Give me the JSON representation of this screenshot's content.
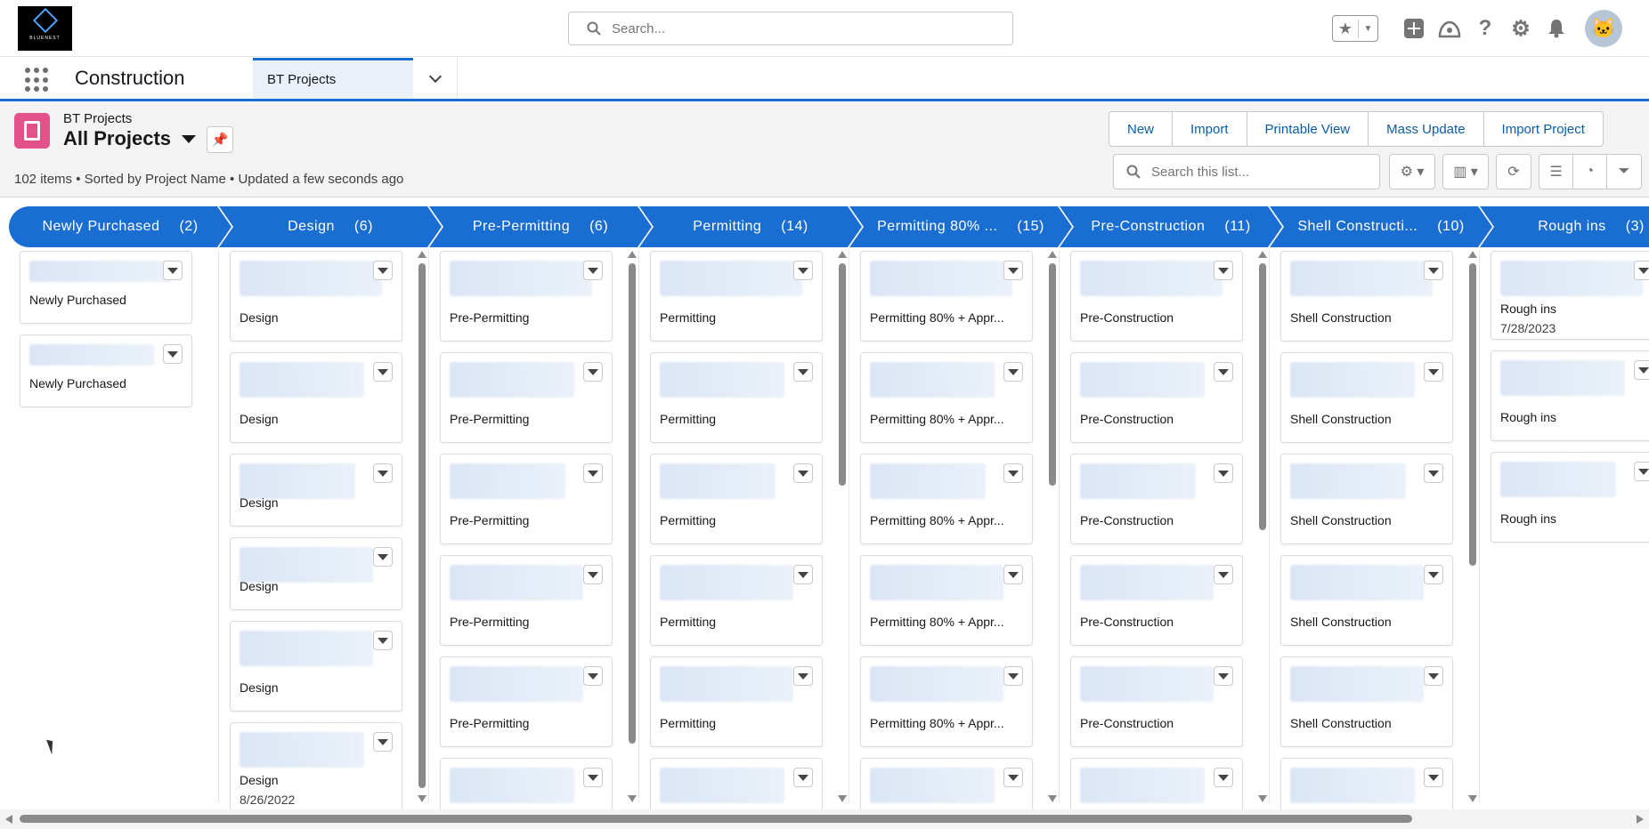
{
  "global_header": {
    "logo_text": "BLUENEST",
    "search_placeholder": "Search...",
    "icons": [
      "star-icon",
      "chevron-down-icon",
      "add-icon",
      "trailhead-icon",
      "help-icon",
      "gear-icon",
      "bell-icon",
      "avatar"
    ]
  },
  "app_nav": {
    "app_name": "Construction",
    "active_tab": "BT Projects"
  },
  "list_header": {
    "object_label": "BT Projects",
    "list_view_name": "All Projects",
    "info": "102 items • Sorted by Project Name • Updated a few seconds ago",
    "buttons": [
      "New",
      "Import",
      "Printable View",
      "Mass Update",
      "Import Project"
    ],
    "search_placeholder": "Search this list..."
  },
  "lanes": [
    {
      "name": "Newly Purchased",
      "count": "(2)",
      "cards": [
        {
          "stage": "Newly Purchased"
        },
        {
          "stage": "Newly Purchased"
        }
      ]
    },
    {
      "name": "Design",
      "count": "(6)",
      "cards": [
        {
          "stage": "Design"
        },
        {
          "stage": "Design"
        },
        {
          "stage": "Design"
        },
        {
          "stage": "Design"
        },
        {
          "stage": "Design"
        },
        {
          "stage": "Design",
          "date": "8/26/2022"
        }
      ]
    },
    {
      "name": "Pre-Permitting",
      "count": "(6)",
      "cards": [
        {
          "stage": "Pre-Permitting"
        },
        {
          "stage": "Pre-Permitting"
        },
        {
          "stage": "Pre-Permitting"
        },
        {
          "stage": "Pre-Permitting"
        },
        {
          "stage": "Pre-Permitting"
        },
        {
          "stage": ""
        }
      ]
    },
    {
      "name": "Permitting",
      "count": "(14)",
      "cards": [
        {
          "stage": "Permitting"
        },
        {
          "stage": "Permitting"
        },
        {
          "stage": "Permitting"
        },
        {
          "stage": "Permitting"
        },
        {
          "stage": "Permitting"
        },
        {
          "stage": ""
        }
      ]
    },
    {
      "name": "Permitting 80% ...",
      "count": "(15)",
      "cards": [
        {
          "stage": "Permitting 80% + Appr..."
        },
        {
          "stage": "Permitting 80% + Appr..."
        },
        {
          "stage": "Permitting 80% + Appr..."
        },
        {
          "stage": "Permitting 80% + Appr..."
        },
        {
          "stage": "Permitting 80% + Appr..."
        },
        {
          "stage": ""
        }
      ]
    },
    {
      "name": "Pre-Construction",
      "count": "(11)",
      "cards": [
        {
          "stage": "Pre-Construction"
        },
        {
          "stage": "Pre-Construction"
        },
        {
          "stage": "Pre-Construction"
        },
        {
          "stage": "Pre-Construction"
        },
        {
          "stage": "Pre-Construction"
        },
        {
          "stage": ""
        }
      ]
    },
    {
      "name": "Shell Constructi...",
      "count": "(10)",
      "cards": [
        {
          "stage": "Shell Construction"
        },
        {
          "stage": "Shell Construction"
        },
        {
          "stage": "Shell Construction"
        },
        {
          "stage": "Shell Construction"
        },
        {
          "stage": "Shell Construction"
        },
        {
          "stage": ""
        }
      ]
    },
    {
      "name": "Rough ins",
      "count": "(3)",
      "cards": [
        {
          "stage": "Rough ins",
          "date": "7/28/2023"
        },
        {
          "stage": "Rough ins"
        },
        {
          "stage": "Rough ins"
        }
      ]
    }
  ]
}
